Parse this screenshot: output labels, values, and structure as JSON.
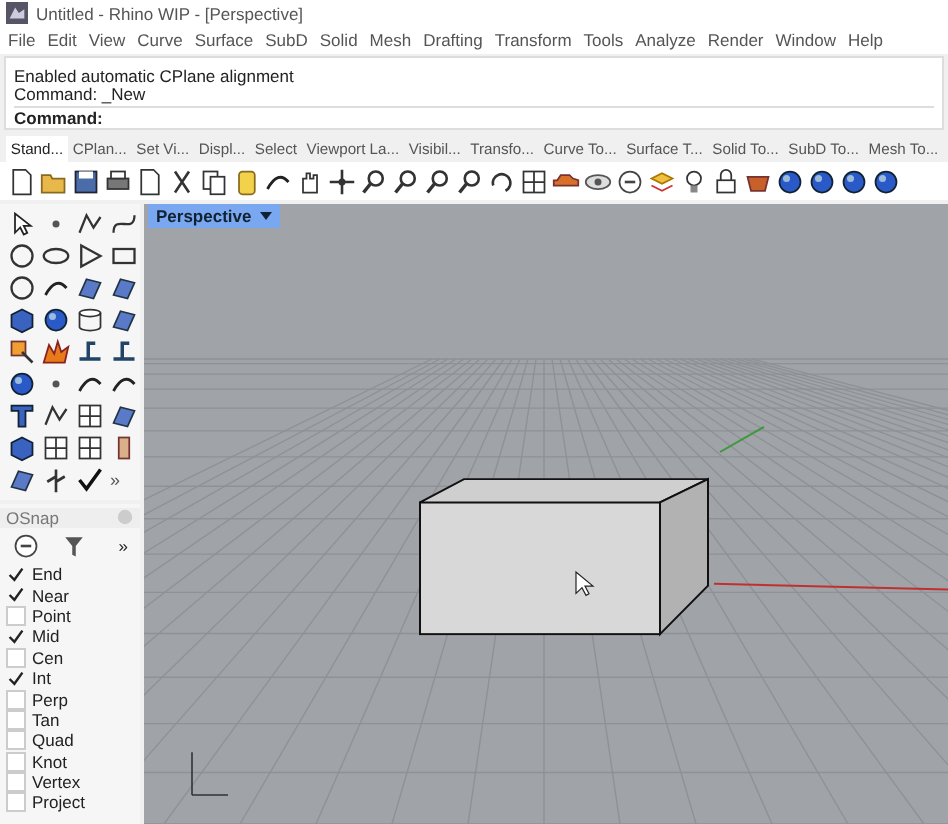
{
  "window": {
    "title": "Untitled - Rhino WIP - [Perspective]"
  },
  "menu": [
    "File",
    "Edit",
    "View",
    "Curve",
    "Surface",
    "SubD",
    "Solid",
    "Mesh",
    "Drafting",
    "Transform",
    "Tools",
    "Analyze",
    "Render",
    "Window",
    "Help"
  ],
  "command_history": [
    "Enabled automatic CPlane alignment",
    "Command: _New"
  ],
  "command_prompt": "Command:",
  "toolbar_tabs": [
    {
      "label": "Stand...",
      "selected": true
    },
    {
      "label": "CPlan...",
      "selected": false
    },
    {
      "label": "Set Vi...",
      "selected": false
    },
    {
      "label": "Displ...",
      "selected": false
    },
    {
      "label": "Select",
      "selected": false
    },
    {
      "label": "Viewport La...",
      "selected": false
    },
    {
      "label": "Visibil...",
      "selected": false
    },
    {
      "label": "Transfo...",
      "selected": false
    },
    {
      "label": "Curve To...",
      "selected": false
    },
    {
      "label": "Surface T...",
      "selected": false
    },
    {
      "label": "Solid To...",
      "selected": false
    },
    {
      "label": "SubD To...",
      "selected": false
    },
    {
      "label": "Mesh To...",
      "selected": false
    }
  ],
  "sidebar": {
    "more": "»"
  },
  "osnap": {
    "title": "OSnap",
    "more": "»",
    "items": [
      {
        "label": "End",
        "checked": true
      },
      {
        "label": "Near",
        "checked": true
      },
      {
        "label": "Point",
        "checked": false
      },
      {
        "label": "Mid",
        "checked": true
      },
      {
        "label": "Cen",
        "checked": false
      },
      {
        "label": "Int",
        "checked": true
      },
      {
        "label": "Perp",
        "checked": false
      },
      {
        "label": "Tan",
        "checked": false
      },
      {
        "label": "Quad",
        "checked": false
      },
      {
        "label": "Knot",
        "checked": false
      },
      {
        "label": "Vertex",
        "checked": false
      },
      {
        "label": "Project",
        "checked": false
      }
    ]
  },
  "viewport": {
    "label": "Perspective"
  }
}
